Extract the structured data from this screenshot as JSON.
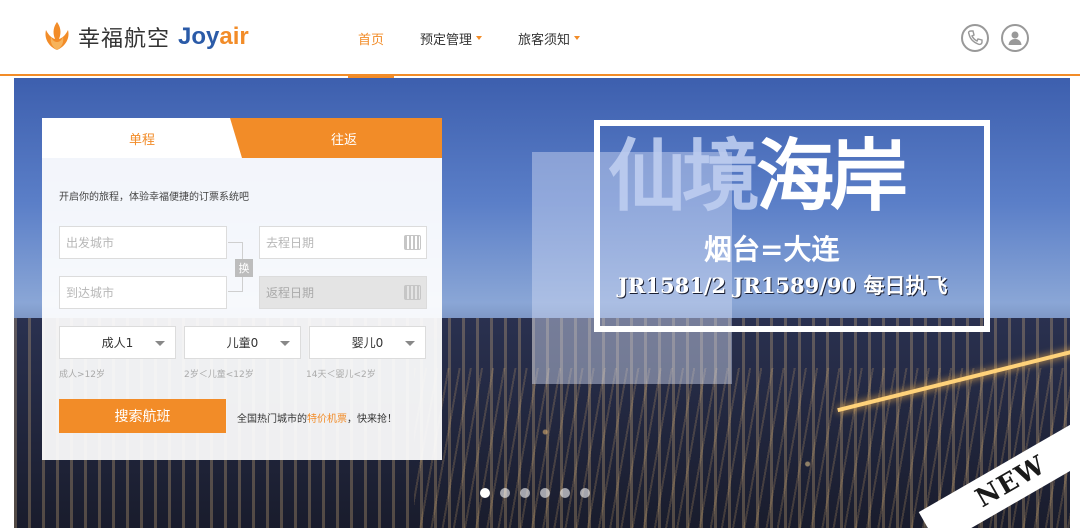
{
  "brand": {
    "name_cn": "幸福航空",
    "name_en_1": "Joy",
    "name_en_2": "air",
    "accent": "#f28c28",
    "blue": "#2b5ba8"
  },
  "nav": [
    {
      "label": "首页",
      "active": true,
      "dropdown": false
    },
    {
      "label": "预定管理",
      "active": false,
      "dropdown": true
    },
    {
      "label": "旅客须知",
      "active": false,
      "dropdown": true
    }
  ],
  "header_icons": [
    "phone-icon",
    "user-icon"
  ],
  "booking": {
    "tabs": {
      "one_way": "单程",
      "round_trip": "往返"
    },
    "intro": "开启你的旅程，体验幸福便捷的订票系统吧",
    "from_placeholder": "出发城市",
    "to_placeholder": "到达城市",
    "depart_placeholder": "去程日期",
    "return_placeholder": "返程日期",
    "swap_label": "换",
    "passengers": [
      {
        "label": "成人1",
        "hint": "成人>12岁"
      },
      {
        "label": "儿童0",
        "hint": "2岁＜儿童<12岁"
      },
      {
        "label": "婴儿0",
        "hint": "14天＜婴儿<2岁"
      }
    ],
    "search_button": "搜索航班",
    "promo_prefix": "全国热门城市的",
    "promo_link": "特价机票",
    "promo_suffix": "，快来抢！"
  },
  "banner": {
    "title_dim": "仙境",
    "title": "海岸",
    "route": "烟台=大连",
    "flights": "JR1581/2 JR1589/90 每日执飞",
    "ribbon": "NEW",
    "slide_count": 6,
    "active_slide": 0
  }
}
